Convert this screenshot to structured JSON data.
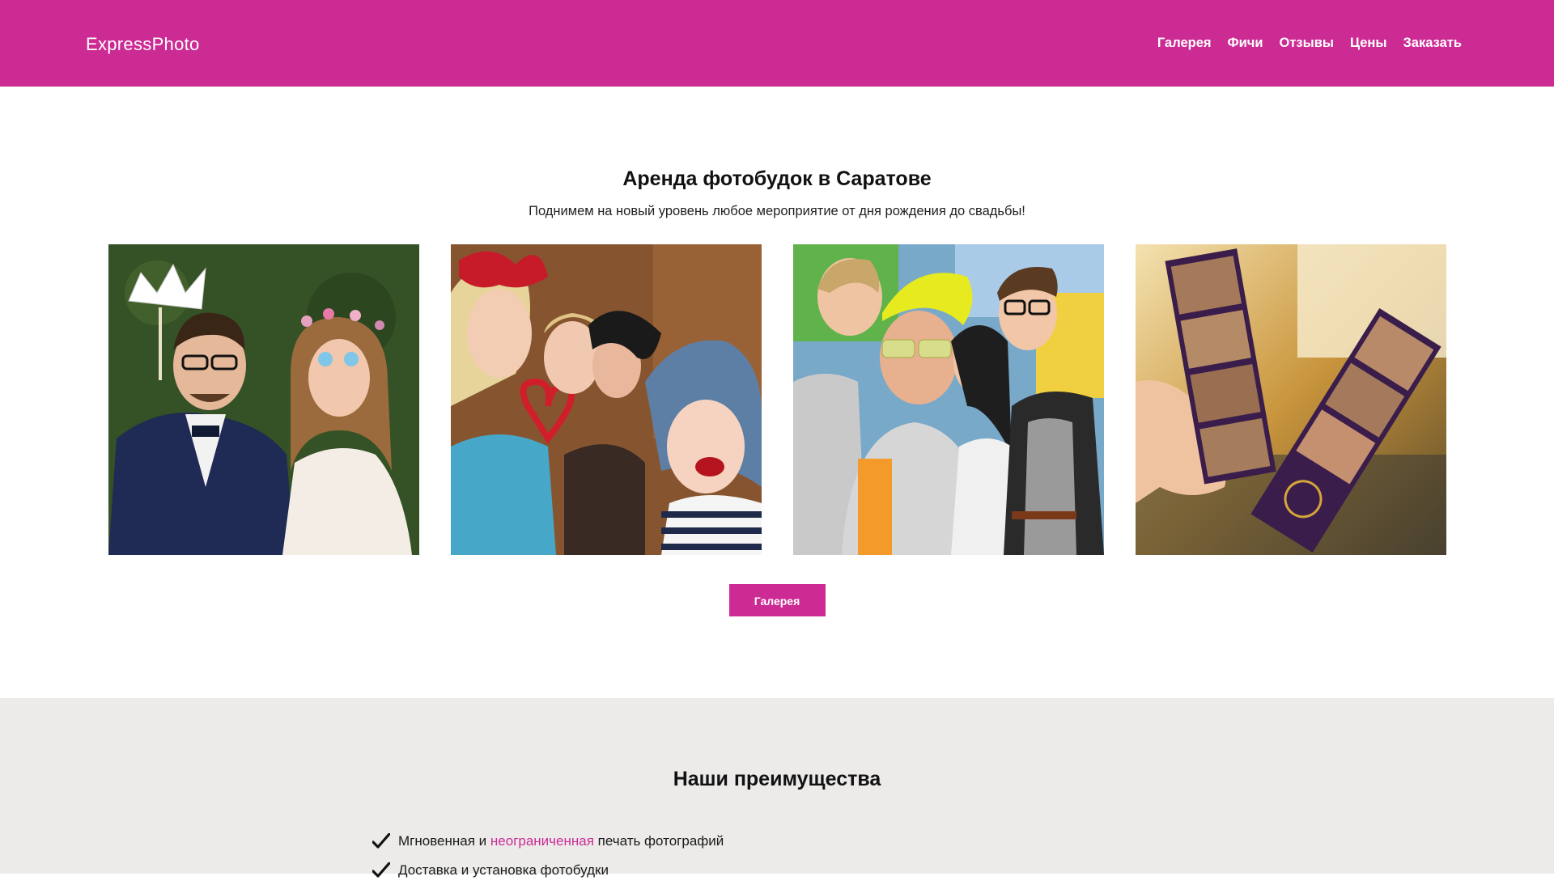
{
  "brand": {
    "name": "ExpressPhoto"
  },
  "nav": {
    "items": [
      "Галерея",
      "Фичи",
      "Отзывы",
      "Цены",
      "Заказать"
    ]
  },
  "hero": {
    "title": "Аренда фотобудок в Саратове",
    "subtitle": "Поднимем на новый уровень любое мероприятие от дня рождения до свадьбы!",
    "button_label": "Галерея"
  },
  "gallery": {
    "photos": [
      {
        "name": "wedding-couple-photo"
      },
      {
        "name": "party-girls-photo"
      },
      {
        "name": "friends-group-photo"
      },
      {
        "name": "photo-strips-photo"
      }
    ]
  },
  "features": {
    "title": "Наши преимущества",
    "items": [
      {
        "before": "Мгновенная и ",
        "accent": "неограниченная",
        "after": " печать фотографий"
      },
      {
        "before": "Доставка и установка фотобудки",
        "accent": "",
        "after": ""
      }
    ]
  },
  "colors": {
    "brand": "#cc2b94",
    "features_bg": "#ecebea"
  },
  "icons": {
    "feature_marker": "check-icon"
  }
}
